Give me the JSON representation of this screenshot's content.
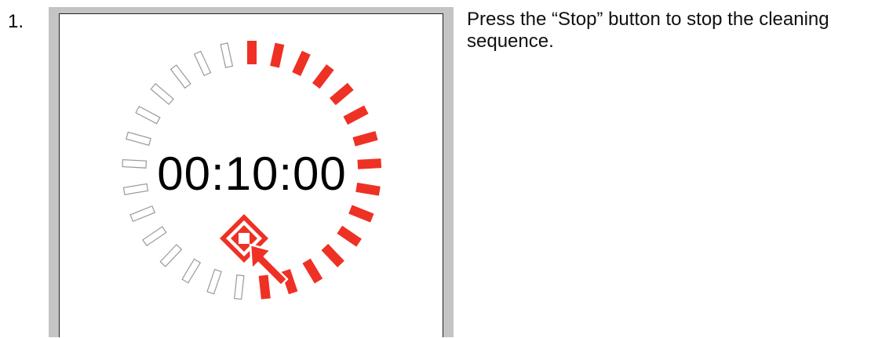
{
  "step": {
    "number": "1.",
    "instruction": "Press the “Stop” button to stop the cleaning sequence."
  },
  "screen": {
    "timer": "00:10:00",
    "progress": {
      "total_segments": 29,
      "completed_segments": 15,
      "completed_color": "#ee3124",
      "remaining_color": "#999999"
    },
    "stop_button": {
      "icon": "stop-icon",
      "pointer": "arrow-pointer-icon",
      "color": "#ee3124"
    }
  }
}
